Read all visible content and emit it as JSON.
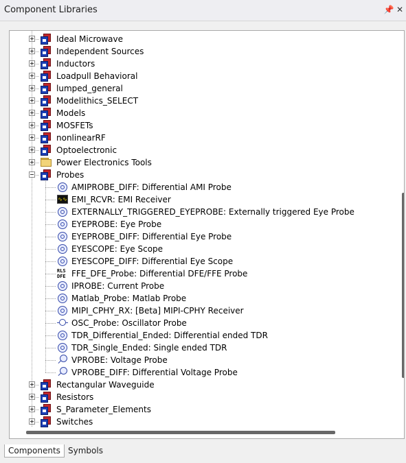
{
  "window": {
    "title": "Component Libraries",
    "pin_icon": "pin-icon",
    "close_icon": "close-icon"
  },
  "tree": {
    "before_probes": [
      {
        "label": "Ideal Microwave",
        "icon": "library-icon"
      },
      {
        "label": "Independent Sources",
        "icon": "library-icon"
      },
      {
        "label": "Inductors",
        "icon": "library-icon"
      },
      {
        "label": "Loadpull Behavioral",
        "icon": "library-icon"
      },
      {
        "label": "lumped_general",
        "icon": "library-icon"
      },
      {
        "label": "Modelithics_SELECT",
        "icon": "library-icon"
      },
      {
        "label": "Models",
        "icon": "library-icon"
      },
      {
        "label": "MOSFETs",
        "icon": "library-icon"
      },
      {
        "label": "nonlinearRF",
        "icon": "library-icon"
      },
      {
        "label": "Optoelectronic",
        "icon": "library-icon"
      },
      {
        "label": "Power Electronics Tools",
        "icon": "folder-icon"
      }
    ],
    "probes": {
      "label": "Probes",
      "icon": "library-icon",
      "children": [
        {
          "label": "AMIPROBE_DIFF: Differential AMI Probe",
          "icon": "probe-icon"
        },
        {
          "label": "EMI_RCVR: EMI Receiver",
          "icon": "emi-receiver-icon"
        },
        {
          "label": "EXTERNALLY_TRIGGERED_EYEPROBE: Externally triggered Eye Probe",
          "icon": "probe-icon"
        },
        {
          "label": "EYEPROBE: Eye Probe",
          "icon": "probe-icon"
        },
        {
          "label": "EYEPROBE_DIFF: Differential Eye Probe",
          "icon": "probe-icon"
        },
        {
          "label": "EYESCOPE: Eye Scope",
          "icon": "probe-icon"
        },
        {
          "label": "EYESCOPE_DIFF: Differential Eye Scope",
          "icon": "probe-icon"
        },
        {
          "label": "FFE_DFE_Probe: Differential DFE/FFE Probe",
          "icon": "dfe-probe-icon"
        },
        {
          "label": "IPROBE: Current Probe",
          "icon": "probe-icon"
        },
        {
          "label": "Matlab_Probe: Matlab Probe",
          "icon": "probe-icon"
        },
        {
          "label": "MIPI_CPHY_RX: [Beta] MIPI-CPHY Receiver",
          "icon": "probe-icon"
        },
        {
          "label": "OSC_Probe: Oscillator Probe",
          "icon": "oscillator-probe-icon"
        },
        {
          "label": "TDR_Differential_Ended: Differential ended TDR",
          "icon": "probe-icon"
        },
        {
          "label": "TDR_Single_Ended: Single ended TDR",
          "icon": "probe-icon"
        },
        {
          "label": "VPROBE: Voltage Probe",
          "icon": "voltage-probe-icon"
        },
        {
          "label": "VPROBE_DIFF: Differential Voltage Probe",
          "icon": "voltage-probe-icon"
        }
      ]
    },
    "after_probes": [
      {
        "label": "Rectangular Waveguide",
        "icon": "library-icon"
      },
      {
        "label": "Resistors",
        "icon": "library-icon"
      },
      {
        "label": "S_Parameter_Elements",
        "icon": "library-icon"
      },
      {
        "label": "Switches",
        "icon": "library-icon"
      }
    ]
  },
  "tabs": [
    {
      "label": "Components",
      "active": true
    },
    {
      "label": "Symbols",
      "active": false
    }
  ]
}
